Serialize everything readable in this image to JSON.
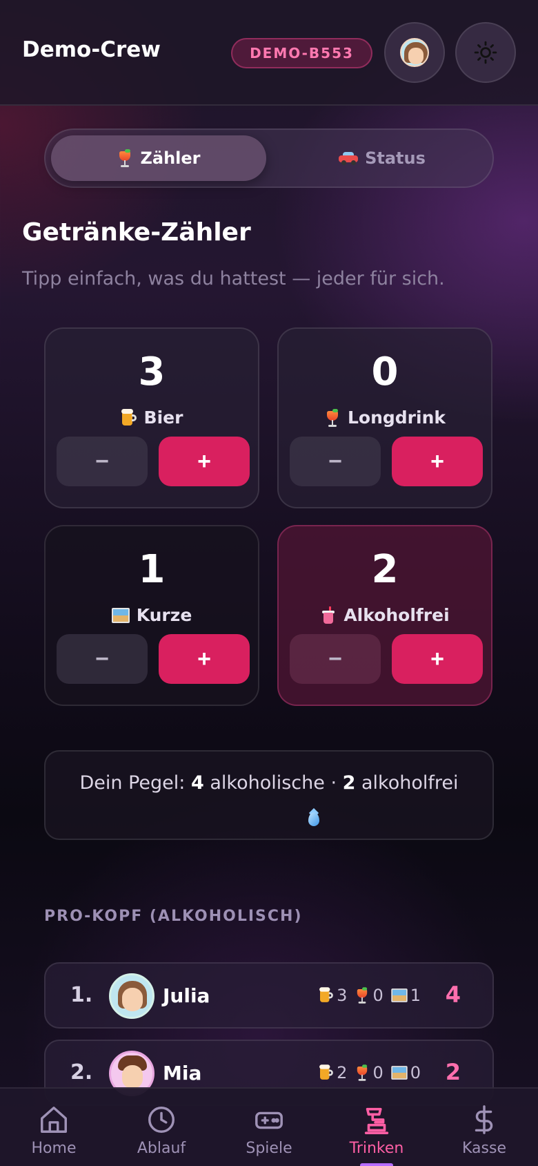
{
  "header": {
    "title": "Demo-Crew",
    "room_code": "DEMO-B553",
    "avatar_icon": "user-avatar-icon",
    "theme_icon": "sun-icon"
  },
  "tabs": [
    {
      "label": "Zähler",
      "icon": "cocktail-icon",
      "active": true
    },
    {
      "label": "Status",
      "icon": "car-icon",
      "active": false
    }
  ],
  "section": {
    "title": "Getränke-Zähler",
    "subtitle": "Tipp einfach, was du hattest — jeder für sich."
  },
  "drinks": [
    {
      "count": "3",
      "label": "Bier",
      "icon": "beer-icon",
      "minus": "−",
      "plus": "+"
    },
    {
      "count": "0",
      "label": "Longdrink",
      "icon": "cocktail-icon",
      "minus": "−",
      "plus": "+"
    },
    {
      "count": "1",
      "label": "Kurze",
      "icon": "shot-icon",
      "minus": "−",
      "plus": "+"
    },
    {
      "count": "2",
      "label": "Alkoholfrei",
      "icon": "cup-with-straw-icon",
      "minus": "−",
      "plus": "+"
    }
  ],
  "summary": {
    "prefix": "Dein Pegel: ",
    "alcoholic_count": "4",
    "alcoholic_label": " alkoholische · ",
    "non_alcoholic_count": "2",
    "non_alcoholic_label": " alkoholfrei",
    "icon": "droplet-icon"
  },
  "ranking": {
    "heading": "PRO-KOPF (ALKOHOLISCH)",
    "rows": [
      {
        "rank": "1.",
        "name": "Julia",
        "beer": "3",
        "longdrink": "0",
        "shots": "1",
        "total": "4"
      },
      {
        "rank": "2.",
        "name": "Mia",
        "beer": "2",
        "longdrink": "0",
        "shots": "0",
        "total": "2"
      }
    ]
  },
  "nav": [
    {
      "label": "Home",
      "icon": "home-icon"
    },
    {
      "label": "Ablauf",
      "icon": "clock-icon"
    },
    {
      "label": "Spiele",
      "icon": "gamepad-icon"
    },
    {
      "label": "Trinken",
      "icon": "beer-tap-icon",
      "active": true
    },
    {
      "label": "Kasse",
      "icon": "dollar-icon"
    }
  ],
  "colors": {
    "accent": "#d9205f",
    "accent_text": "#ff6fae",
    "active_nav": "#ff5fa5"
  }
}
